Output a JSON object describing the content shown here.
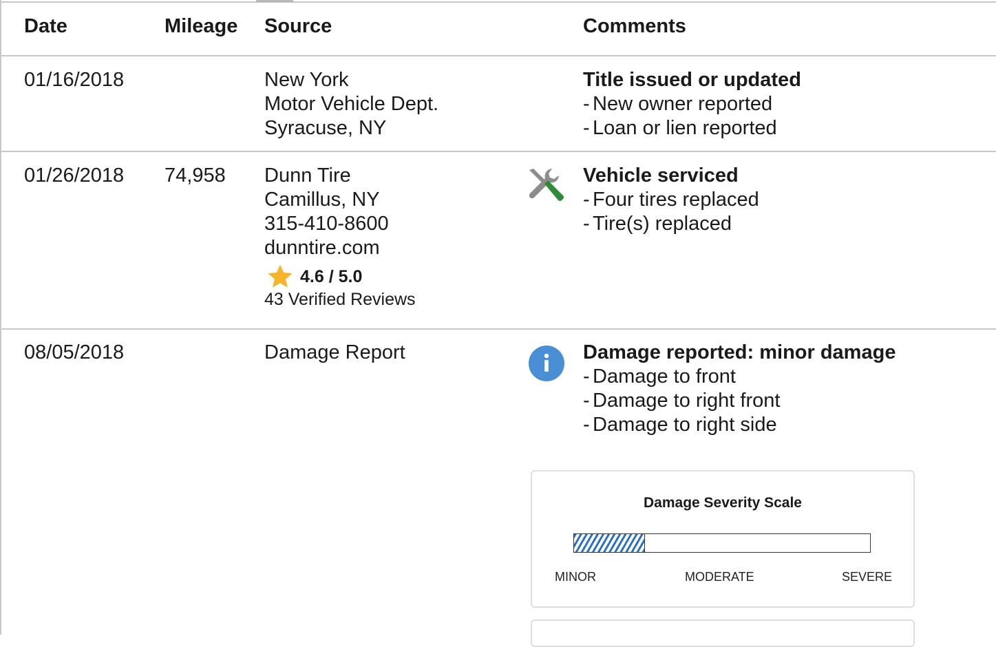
{
  "header": {
    "date": "Date",
    "mileage": "Mileage",
    "source": "Source",
    "comments": "Comments"
  },
  "rows": [
    {
      "date": "01/16/2018",
      "mileage": "",
      "source": [
        "New York",
        "Motor Vehicle Dept.",
        "Syracuse, NY"
      ],
      "title": "Title issued or updated",
      "items": [
        "New owner reported",
        "Loan or lien reported"
      ]
    },
    {
      "date": "01/26/2018",
      "mileage": "74,958",
      "source": [
        "Dunn Tire",
        "Camillus, NY",
        "315-410-8600",
        "dunntire.com"
      ],
      "rating": "4.6 / 5.0",
      "reviews": "43 Verified Reviews",
      "icon": "wrench-screwdriver-icon",
      "title": "Vehicle serviced",
      "items": [
        "Four tires replaced",
        "Tire(s) replaced"
      ]
    },
    {
      "date": "08/05/2018",
      "mileage": "",
      "source": [
        "Damage Report"
      ],
      "icon": "info-icon",
      "title": "Damage reported: minor damage",
      "items": [
        "Damage to front",
        "Damage to right front",
        "Damage to right side"
      ]
    }
  ],
  "severity": {
    "title": "Damage Severity Scale",
    "labels": [
      "MINOR",
      "MODERATE",
      "SEVERE"
    ],
    "level": 0.24,
    "fill_color": "#2d6fc2"
  },
  "colors": {
    "star": "#f5b52a",
    "info_icon": "#4a8fd6",
    "screwdriver_handle": "#2e8b3a"
  }
}
